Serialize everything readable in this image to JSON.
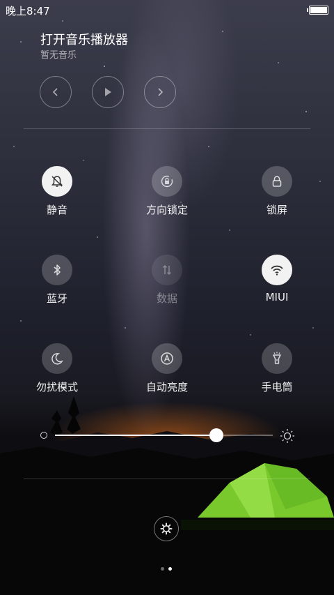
{
  "status_bar": {
    "time": "晚上8:47"
  },
  "music": {
    "title": "打开音乐播放器",
    "subtitle": "暂无音乐"
  },
  "toggles": [
    {
      "label": "静音",
      "icon": "mute-bell-icon",
      "state": "on"
    },
    {
      "label": "方向锁定",
      "icon": "rotation-lock-icon",
      "state": "off"
    },
    {
      "label": "锁屏",
      "icon": "lock-icon",
      "state": "off"
    },
    {
      "label": "蓝牙",
      "icon": "bluetooth-icon",
      "state": "off"
    },
    {
      "label": "数据",
      "icon": "mobile-data-icon",
      "state": "disabled"
    },
    {
      "label": "MIUI",
      "icon": "wifi-icon",
      "state": "on"
    },
    {
      "label": "勿扰模式",
      "icon": "moon-icon",
      "state": "off"
    },
    {
      "label": "自动亮度",
      "icon": "auto-brightness-icon",
      "state": "off"
    },
    {
      "label": "手电筒",
      "icon": "flashlight-icon",
      "state": "off"
    }
  ],
  "brightness": {
    "level": 0.74
  },
  "pager": {
    "pages": 2,
    "current": 2
  },
  "colors": {
    "tile_on": "#f2f2f2",
    "tile_off": "rgba(255,255,255,0.2)",
    "tent": "#7fd42f"
  }
}
